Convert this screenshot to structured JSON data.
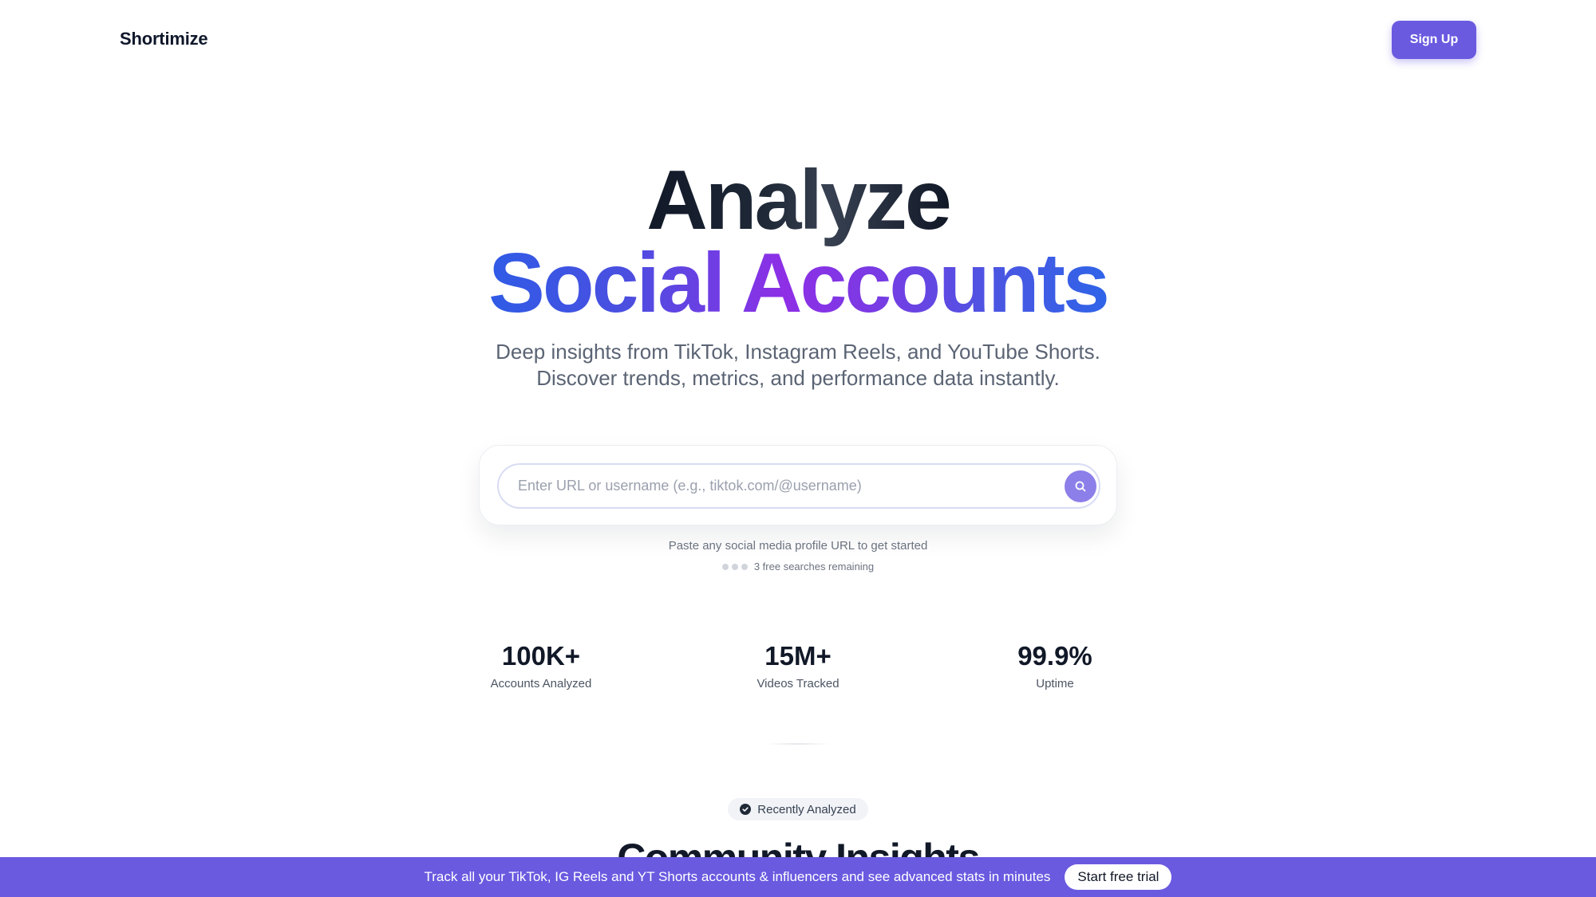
{
  "header": {
    "logo": "Shortimize",
    "signup_label": "Sign Up"
  },
  "hero": {
    "title_line1": "Analyze",
    "title_line2": "Social Accounts",
    "subtitle_line1": "Deep insights from TikTok, Instagram Reels, and YouTube Shorts.",
    "subtitle_line2": "Discover trends, metrics, and performance data instantly."
  },
  "search": {
    "placeholder": "Enter URL or username (e.g., tiktok.com/@username)",
    "value": "",
    "button_icon": "search-icon",
    "hint": "Paste any social media profile URL to get started",
    "remaining": "3 free searches remaining",
    "remaining_count": 3
  },
  "stats": [
    {
      "value": "100K+",
      "label": "Accounts Analyzed"
    },
    {
      "value": "15M+",
      "label": "Videos Tracked"
    },
    {
      "value": "99.9%",
      "label": "Uptime"
    }
  ],
  "recent": {
    "badge": "Recently Analyzed",
    "badge_icon": "check-circle-icon",
    "heading": "Community Insights"
  },
  "banner": {
    "text": "Track all your TikTok, IG Reels and YT Shorts accounts & influencers and see advanced stats in minutes",
    "cta": "Start free trial"
  },
  "colors": {
    "accent": "#6a5ae0",
    "gradient_blue": "#2f5be6",
    "gradient_purple": "#8e2fe6"
  }
}
